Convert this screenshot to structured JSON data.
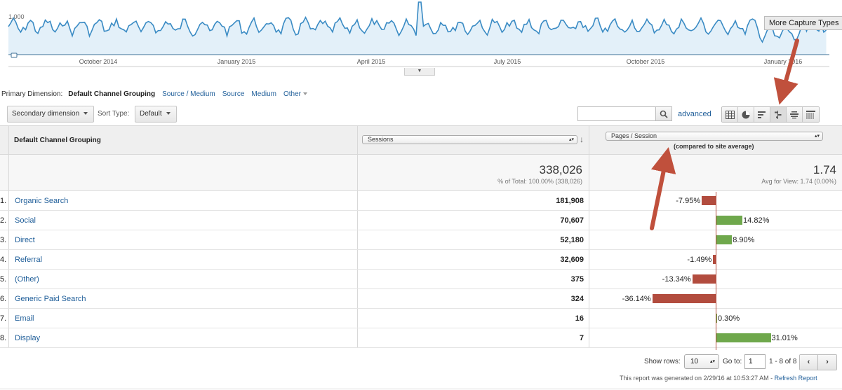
{
  "chart": {
    "y_label": "1,000",
    "x_ticks": [
      "October 2014",
      "January 2015",
      "April 2015",
      "July 2015",
      "October 2015",
      "January 2016"
    ],
    "toggle_label": "▼",
    "tooltip": "More Capture Types",
    "line_color": "#3a8bc4",
    "fill_color": "#e3f0f9"
  },
  "primary_dimension": {
    "label": "Primary Dimension:",
    "active": "Default Channel Grouping",
    "links": [
      "Source / Medium",
      "Source",
      "Medium",
      "Other"
    ]
  },
  "toolbar": {
    "secondary_dimension": "Secondary dimension",
    "sort_type_label": "Sort Type:",
    "sort_type_value": "Default",
    "search_value": "",
    "advanced": "advanced",
    "view_icons": [
      "table-view-icon",
      "pie-view-icon",
      "performance-view-icon",
      "comparison-view-icon",
      "term-cloud-view-icon",
      "pivot-view-icon"
    ]
  },
  "table": {
    "dimension_header": "Default Channel Grouping",
    "metric1_header": "Sessions",
    "metric2_header": "Pages / Session",
    "compare_note": "(compared to site average)",
    "totals": {
      "sessions": "338,026",
      "sessions_sub": "% of Total: 100.00% (338,026)",
      "pages": "1.74",
      "pages_sub": "Avg for View: 1.74 (0.00%)"
    },
    "rows": [
      {
        "idx": "1.",
        "name": "Organic Search",
        "sessions": "181,908",
        "pct": "-7.95%",
        "delta": -7.95
      },
      {
        "idx": "2.",
        "name": "Social",
        "sessions": "70,607",
        "pct": "14.82%",
        "delta": 14.82
      },
      {
        "idx": "3.",
        "name": "Direct",
        "sessions": "52,180",
        "pct": "8.90%",
        "delta": 8.9
      },
      {
        "idx": "4.",
        "name": "Referral",
        "sessions": "32,609",
        "pct": "-1.49%",
        "delta": -1.49
      },
      {
        "idx": "5.",
        "name": "(Other)",
        "sessions": "375",
        "pct": "-13.34%",
        "delta": -13.34
      },
      {
        "idx": "6.",
        "name": "Generic Paid Search",
        "sessions": "324",
        "pct": "-36.14%",
        "delta": -36.14
      },
      {
        "idx": "7.",
        "name": "Email",
        "sessions": "16",
        "pct": "0.30%",
        "delta": 0.3
      },
      {
        "idx": "8.",
        "name": "Display",
        "sessions": "7",
        "pct": "31.01%",
        "delta": 31.01
      }
    ]
  },
  "pager": {
    "show_rows_label": "Show rows:",
    "show_rows_value": "10",
    "goto_label": "Go to:",
    "goto_value": "1",
    "range": "1 - 8 of 8",
    "prev": "‹",
    "next": "›"
  },
  "footer": {
    "generated": "This report was generated on 2/29/16 at 10:53:27 AM - ",
    "refresh": "Refresh Report"
  },
  "colors": {
    "negative_bar": "#b24c3e",
    "positive_bar": "#6fa84c",
    "annotation_arrow": "#c0503c"
  }
}
